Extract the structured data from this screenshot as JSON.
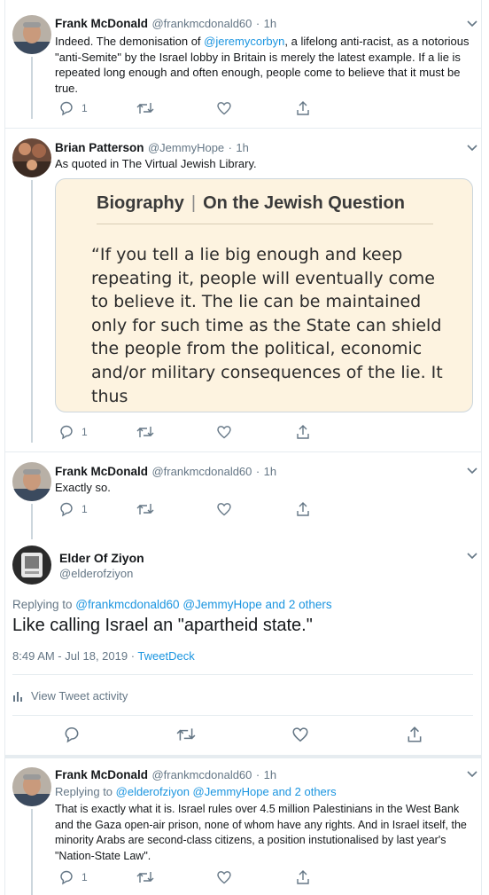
{
  "tweet1": {
    "name": "Frank McDonald",
    "handle": "@frankmcdonald60",
    "time": "1h",
    "text_before": "Indeed. The demonisation of ",
    "mention": "@jeremycorbyn",
    "text_after": ", a lifelong anti-racist, as a notorious \"anti-Semite\" by the Israel lobby in Britain is merely the latest example. If a lie is repeated long enough and often enough, people come to believe that it must be true.",
    "reply_count": "1"
  },
  "tweet2": {
    "name": "Brian Patterson",
    "handle": "@JemmyHope",
    "time": "1h",
    "text": "As quoted in The Virtual Jewish Library.",
    "card_title_left": "Biography",
    "card_title_sep": "|",
    "card_title_right": "On the Jewish Question",
    "card_quote": "“If you tell a lie big enough and keep repeating it, people will eventually come to believe it. The lie can be maintained only for such time as the State can shield the people from the political, economic and/or military consequences of the lie. It thus",
    "reply_count": "1"
  },
  "tweet3": {
    "name": "Frank McDonald",
    "handle": "@frankmcdonald60",
    "time": "1h",
    "text": "Exactly so.",
    "reply_count": "1"
  },
  "focus": {
    "name": "Elder Of Ziyon",
    "handle": "@elderofziyon",
    "replying_label": "Replying to ",
    "replying_mentions": "@frankmcdonald60 @JemmyHope and 2 others",
    "text": "Like calling Israel an \"apartheid state.\"",
    "timestamp": "8:49 AM - Jul 18, 2019 · ",
    "source": "TweetDeck",
    "activity": "View Tweet activity"
  },
  "tweet4": {
    "name": "Frank McDonald",
    "handle": "@frankmcdonald60",
    "time": "1h",
    "replying_label": "Replying to ",
    "replying_mentions": "@elderofziyon @JemmyHope and 2 others",
    "text": "That is exactly what it is. Israel rules over 4.5 million Palestinians in the West Bank and the Gaza open-air prison, none of whom have any rights. And in Israel itself, the minority Arabs are second-class citizens, a position instutionalised by last year's \"Nation-State Law\".",
    "reply_count": "1"
  },
  "icons": [
    "reply-icon",
    "retweet-icon",
    "like-icon",
    "share-icon",
    "chevron-down-icon",
    "analytics-icon"
  ],
  "colors": {
    "link": "#1b95e0",
    "secondary": "#657786",
    "card_bg": "#fdf3e0"
  }
}
